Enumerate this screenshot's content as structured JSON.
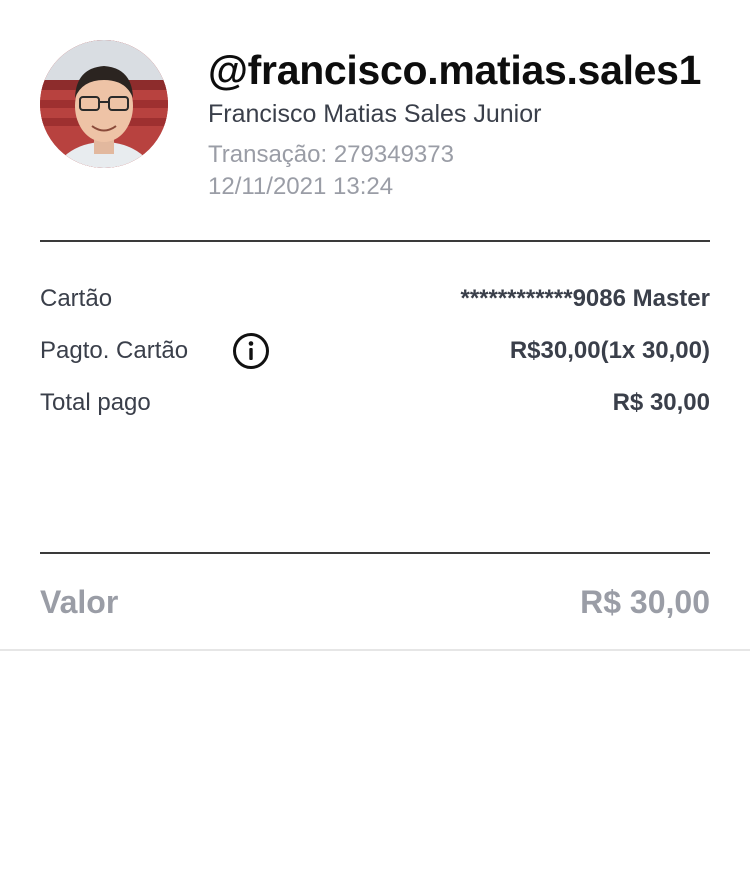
{
  "profile": {
    "avatar_alt": "user-avatar-photo",
    "username": "@francisco.matias.sales1",
    "full_name": "Francisco Matias Sales Junior",
    "transaction": "Transação: 279349373",
    "datetime": "12/11/2021 13:24"
  },
  "details": {
    "rows": [
      {
        "label": "Cartão",
        "value": "************9086 Master"
      },
      {
        "label": "Pagto. Cartão",
        "value": "R$30,00(1x 30,00)",
        "icon": "info-circle-icon"
      },
      {
        "label": "Total pago",
        "value": "R$ 30,00"
      }
    ]
  },
  "summary": {
    "label": "Valor",
    "value": "R$ 30,00"
  },
  "colors": {
    "primary_text": "#0d0d0d",
    "secondary_text": "#3a3f4a",
    "muted_text": "#9a9da6",
    "divider": "#3a3a3a"
  }
}
